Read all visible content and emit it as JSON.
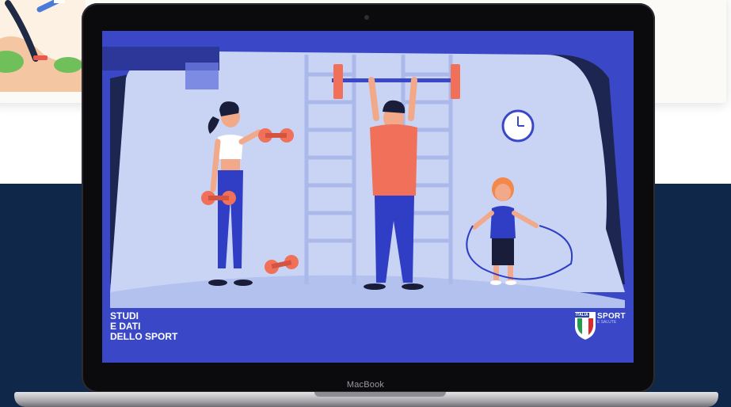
{
  "video": {
    "caption_lines": [
      "STUDI",
      "E DATI",
      "DELLO SPORT"
    ],
    "brand": {
      "badge": "ITALIA",
      "name": "SPORT",
      "sub": "E SALUTE"
    }
  },
  "device": {
    "label": "MacBook"
  },
  "colors": {
    "page_dark": "#0f2749",
    "screen_blue": "#3a48c8",
    "wall": "#c9d4f5",
    "accent_coral": "#f0705a",
    "pants_blue": "#2f3ec4"
  }
}
